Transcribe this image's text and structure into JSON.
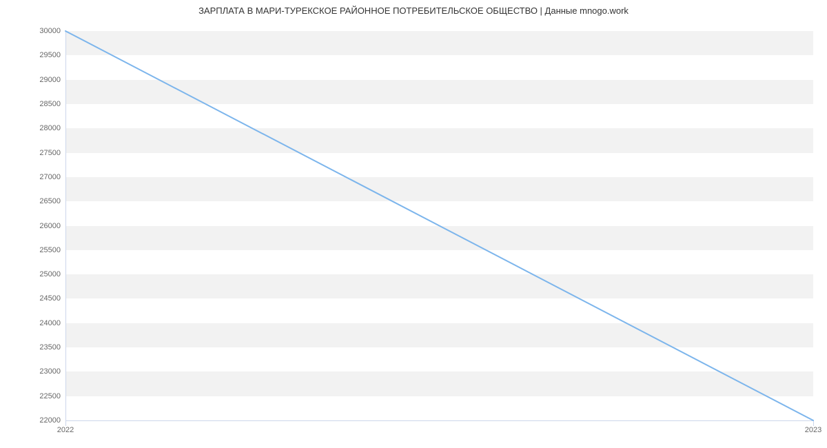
{
  "chart_data": {
    "type": "line",
    "title": "ЗАРПЛАТА В МАРИ-ТУРЕКСКОЕ РАЙОННОЕ ПОТРЕБИТЕЛЬСКОЕ ОБЩЕСТВО | Данные mnogo.work",
    "xlabel": "",
    "ylabel": "",
    "x": [
      "2022",
      "2023"
    ],
    "values": [
      30000,
      22000
    ],
    "ylim": [
      22000,
      30000
    ],
    "y_ticks": [
      22000,
      22500,
      23000,
      23500,
      24000,
      24500,
      25000,
      25500,
      26000,
      26500,
      27000,
      27500,
      28000,
      28500,
      29000,
      29500,
      30000
    ],
    "x_ticks": [
      "2022",
      "2023"
    ],
    "line_color": "#7cb5ec"
  }
}
